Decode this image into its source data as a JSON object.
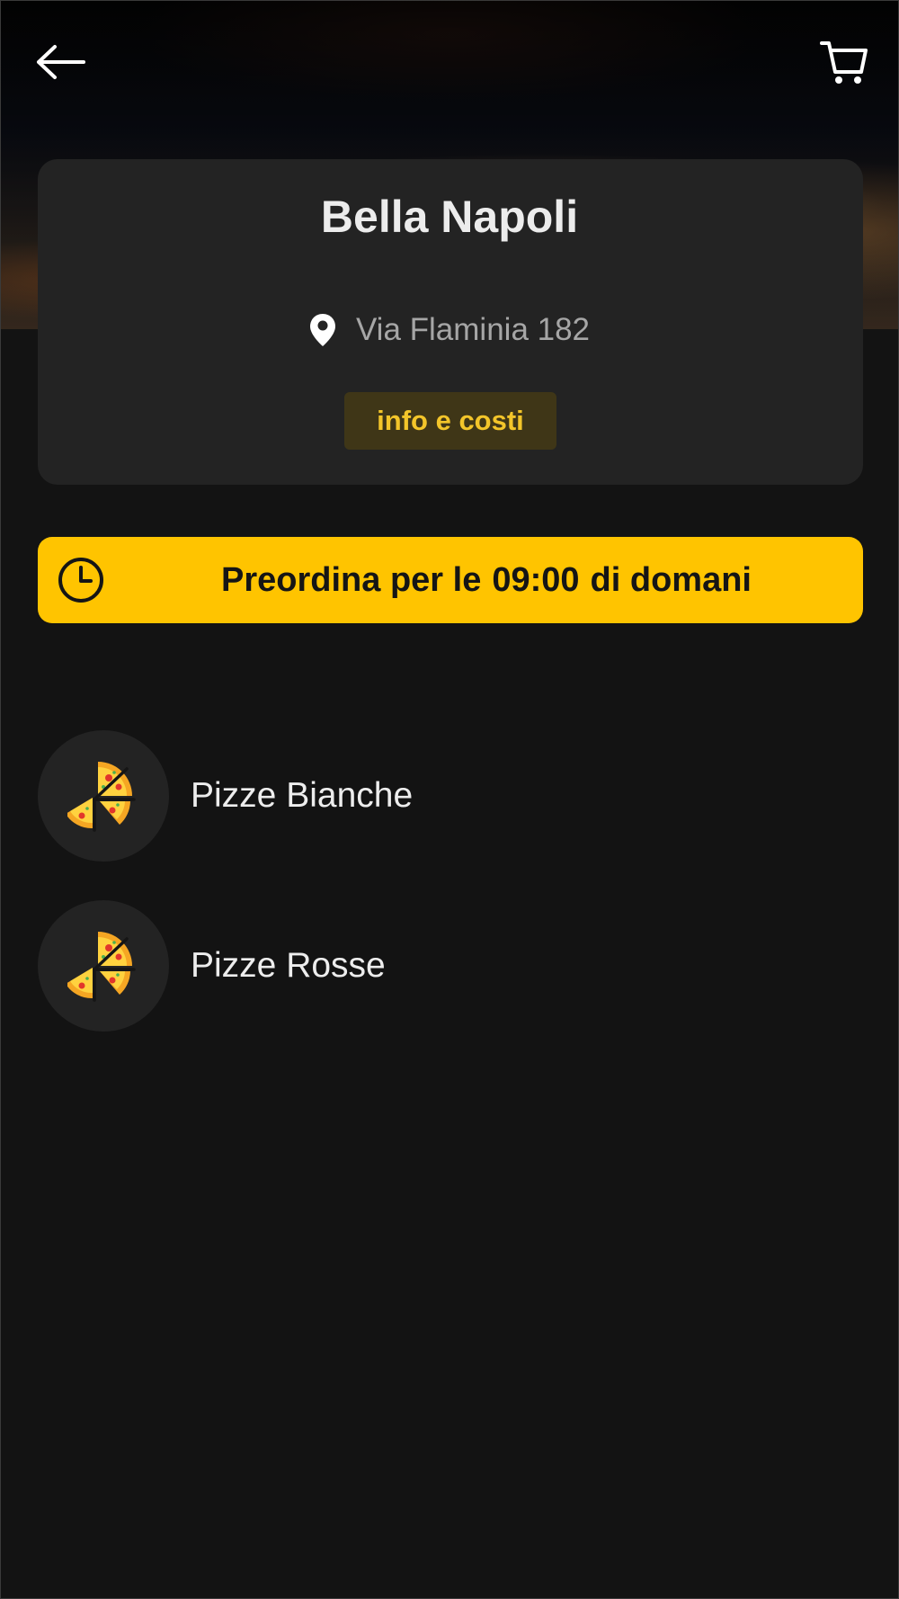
{
  "header": {
    "back_icon": "arrow-left-icon",
    "cart_icon": "shopping-cart-icon"
  },
  "restaurant": {
    "name": "Bella Napoli",
    "address_icon": "location-pin-icon",
    "address": "Via Flaminia 182",
    "info_button_label": "info e costi"
  },
  "preorder_banner": {
    "icon": "clock-icon",
    "prefix": "Preordina per le",
    "time": "09:00",
    "suffix": "di domani",
    "background_color": "#ffc400"
  },
  "categories": [
    {
      "label": "Pizze Bianche",
      "icon": "pizza-slices-icon"
    },
    {
      "label": "Pizze Rosse",
      "icon": "pizza-slices-icon"
    }
  ],
  "colors": {
    "background": "#131313",
    "card": "#232323",
    "accent": "#f3c52a"
  }
}
